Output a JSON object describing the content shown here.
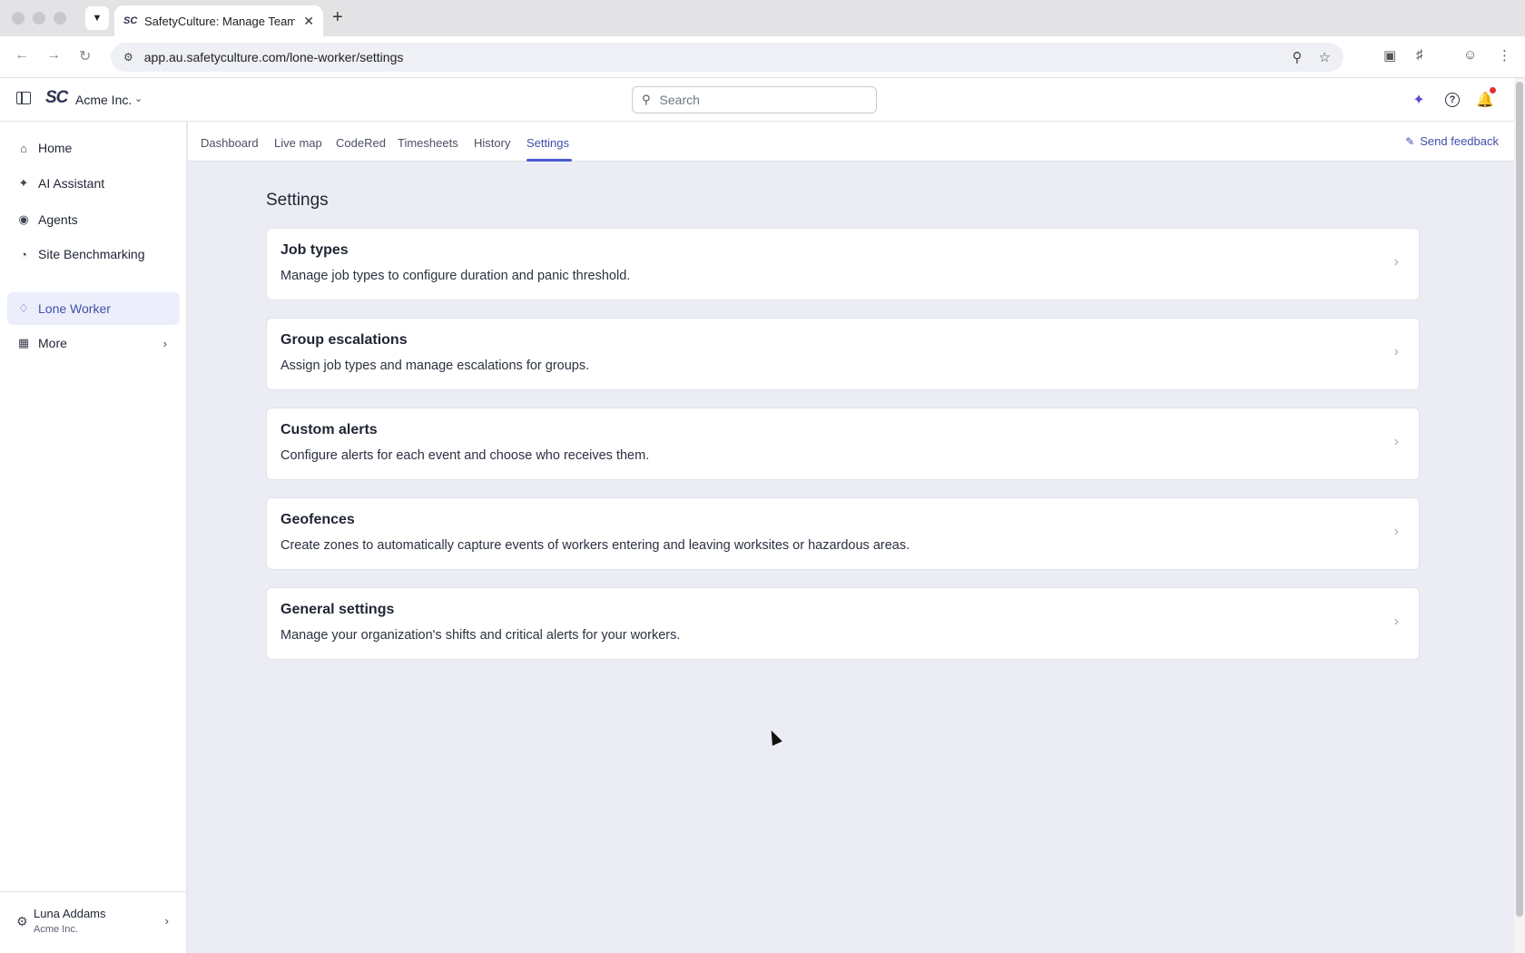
{
  "browser": {
    "tab_title": "SafetyCulture: Manage Teams",
    "tab_favicon": "SC",
    "url": "app.au.safetyculture.com/lone-worker/settings"
  },
  "header": {
    "logo": "SC",
    "org_name": "Acme Inc.",
    "search_placeholder": "Search"
  },
  "sidebar": {
    "items": [
      {
        "label": "Home",
        "icon": "home-icon"
      },
      {
        "label": "AI Assistant",
        "icon": "sparkle-icon"
      },
      {
        "label": "Agents",
        "icon": "robot-icon"
      },
      {
        "label": "Site Benchmarking",
        "icon": "gauge-icon"
      },
      {
        "label": "Lone Worker",
        "icon": "worker-icon",
        "active": true
      },
      {
        "label": "More",
        "icon": "grid-icon"
      }
    ],
    "user": {
      "name": "Luna Addams",
      "org": "Acme Inc."
    }
  },
  "subnav": {
    "tabs": [
      "Dashboard",
      "Live map",
      "CodeRed",
      "Timesheets",
      "History",
      "Settings"
    ],
    "active": "Settings",
    "feedback_label": "Send feedback"
  },
  "page": {
    "title": "Settings",
    "cards": [
      {
        "title": "Job types",
        "desc": "Manage job types to configure duration and panic threshold."
      },
      {
        "title": "Group escalations",
        "desc": "Assign job types and manage escalations for groups."
      },
      {
        "title": "Custom alerts",
        "desc": "Configure alerts for each event and choose who receives them."
      },
      {
        "title": "Geofences",
        "desc": "Create zones to automatically capture events of workers entering and leaving worksites or hazardous areas."
      },
      {
        "title": "General settings",
        "desc": "Manage your organization's shifts and critical alerts for your workers."
      }
    ]
  },
  "colors": {
    "accent": "#3f4fa8",
    "notification": "#e0342f",
    "background": "#ecedf4"
  }
}
